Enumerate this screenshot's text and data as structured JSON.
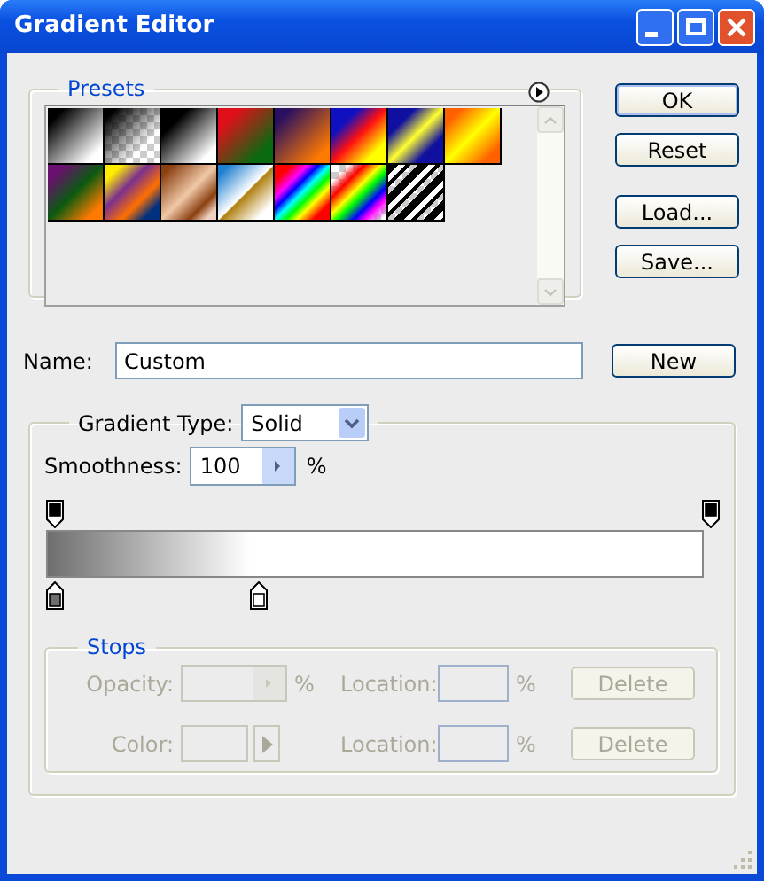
{
  "window": {
    "title": "Gradient Editor"
  },
  "title_buttons": [
    {
      "kind": "minimize"
    },
    {
      "kind": "maximize"
    },
    {
      "kind": "close"
    }
  ],
  "presets": {
    "legend": "Presets"
  },
  "buttons": [
    {
      "label": "OK",
      "default": true
    },
    {
      "label": "Reset",
      "default": false
    },
    {
      "label": "Load...",
      "default": false
    },
    {
      "label": "Save...",
      "default": false
    }
  ],
  "name": {
    "label": "Name:",
    "value": "Custom"
  },
  "new_button": {
    "label": "New"
  },
  "gradient_type": {
    "label": "Gradient Type:",
    "value": "Solid"
  },
  "smoothness": {
    "label": "Smoothness:",
    "value": "100",
    "unit": "%"
  },
  "opacity_stops": [
    {
      "color": "#000000"
    },
    {
      "color": "#000000"
    }
  ],
  "color_stops": [
    {
      "color": "#6e6e6e"
    },
    {
      "color": "#ffffff"
    }
  ],
  "stops": {
    "legend": "Stops",
    "rows": [
      {
        "kind": "opacity",
        "label": "Opacity:",
        "unit": "%",
        "location_label": "Location:",
        "location_unit": "%",
        "button": "Delete",
        "disabled": true
      },
      {
        "kind": "color",
        "label": "Color:",
        "location_label": "Location:",
        "location_unit": "%",
        "button": "Delete",
        "disabled": true
      }
    ]
  }
}
